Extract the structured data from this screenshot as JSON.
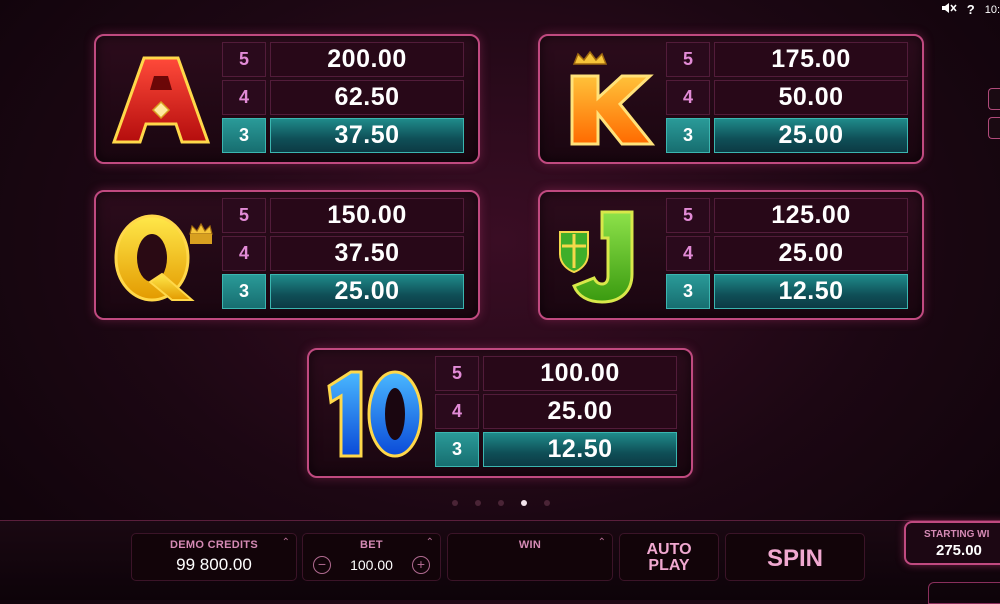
{
  "topbar": {
    "mute_icon": "speaker-mute-icon",
    "help": "?",
    "time": "10:"
  },
  "paytable": [
    {
      "symbol": "A",
      "pays": [
        {
          "count": "5",
          "value": "200.00"
        },
        {
          "count": "4",
          "value": "62.50"
        },
        {
          "count": "3",
          "value": "37.50"
        }
      ]
    },
    {
      "symbol": "K",
      "pays": [
        {
          "count": "5",
          "value": "175.00"
        },
        {
          "count": "4",
          "value": "50.00"
        },
        {
          "count": "3",
          "value": "25.00"
        }
      ]
    },
    {
      "symbol": "Q",
      "pays": [
        {
          "count": "5",
          "value": "150.00"
        },
        {
          "count": "4",
          "value": "37.50"
        },
        {
          "count": "3",
          "value": "25.00"
        }
      ]
    },
    {
      "symbol": "J",
      "pays": [
        {
          "count": "5",
          "value": "125.00"
        },
        {
          "count": "4",
          "value": "25.00"
        },
        {
          "count": "3",
          "value": "12.50"
        }
      ]
    },
    {
      "symbol": "10",
      "pays": [
        {
          "count": "5",
          "value": "100.00"
        },
        {
          "count": "4",
          "value": "25.00"
        },
        {
          "count": "3",
          "value": "12.50"
        }
      ]
    }
  ],
  "pagination": {
    "total": 5,
    "active_index": 3
  },
  "controls": {
    "credits_label": "DEMO CREDITS",
    "credits_value": "99 800.00",
    "bet_label": "BET",
    "bet_value": "100.00",
    "minus": "−",
    "plus": "+",
    "win_label": "WIN",
    "win_value": "",
    "autoplay_line1": "AUTO",
    "autoplay_line2": "PLAY",
    "spin_label": "SPIN",
    "starting_label": "STARTING WI",
    "starting_value": "275.00"
  },
  "colors": {
    "accent": "#c04a80",
    "highlight": "#1f8a8a",
    "background": "#1c0713"
  }
}
